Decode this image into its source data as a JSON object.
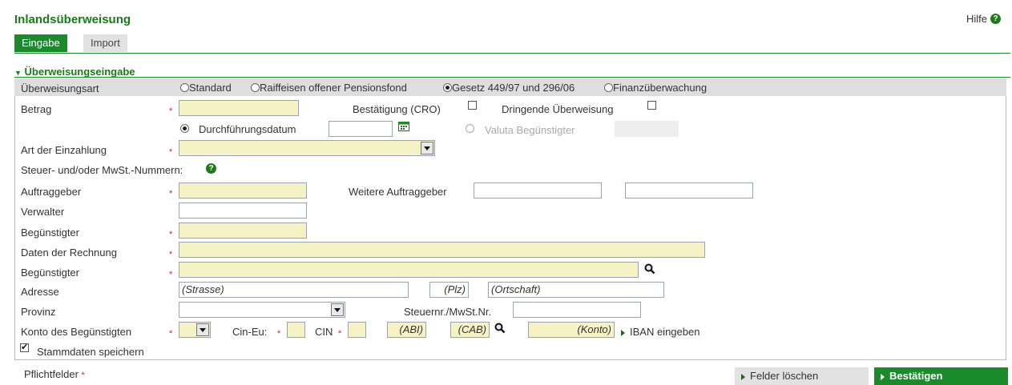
{
  "header": {
    "title": "Inlandsüberweisung",
    "help_label": "Hilfe"
  },
  "tabs": [
    {
      "label": "Eingabe",
      "active": true
    },
    {
      "label": "Import",
      "active": false
    }
  ],
  "section": {
    "title": "Überweisungseingabe"
  },
  "transfer_type": {
    "label": "Überweisungsart",
    "options": [
      "Standard",
      "Raiffeisen offener Pensionsfond",
      "Gesetz 449/97 und 296/06",
      "Finanzüberwachung"
    ],
    "selected": "Gesetz 449/97 und 296/06"
  },
  "fields": {
    "betrag": "Betrag",
    "bestaetigung": "Bestätigung (CRO)",
    "dringend": "Dringende Überweisung",
    "durchfuehrung": "Durchführungsdatum",
    "valuta": "Valuta Begünstigter",
    "art_einzahlung": "Art der Einzahlung",
    "steuer": "Steuer- und/oder MwSt.-Nummern:",
    "auftraggeber": "Auftraggeber",
    "weitere": "Weitere Auftraggeber",
    "verwalter": "Verwalter",
    "beguenstigter1": "Begünstigter",
    "daten_rechnung": "Daten der Rechnung",
    "beguenstigter2": "Begünstigter",
    "adresse": "Adresse",
    "provinz": "Provinz",
    "steuernr": "Steuernr./MwSt.Nr.",
    "konto": "Konto des Begünstigten",
    "cin_eu": "Cin-Eu:",
    "cin": "CIN",
    "iban": "IBAN eingeben",
    "stammdaten": "Stammdaten speichern"
  },
  "placeholders": {
    "strasse": "(Strasse)",
    "plz": "(Plz)",
    "ortschaft": "(Ortschaft)",
    "abi": "(ABI)",
    "cab": "(CAB)",
    "konto": "(Konto)"
  },
  "footer": {
    "pflicht": "Pflichtfelder",
    "required_mark": "*",
    "clear_button": "Felder löschen",
    "confirm_button": "Bestätigen"
  },
  "colors": {
    "brand_green": "#1a8a2a",
    "required_yellow": "#f5f3c6"
  }
}
